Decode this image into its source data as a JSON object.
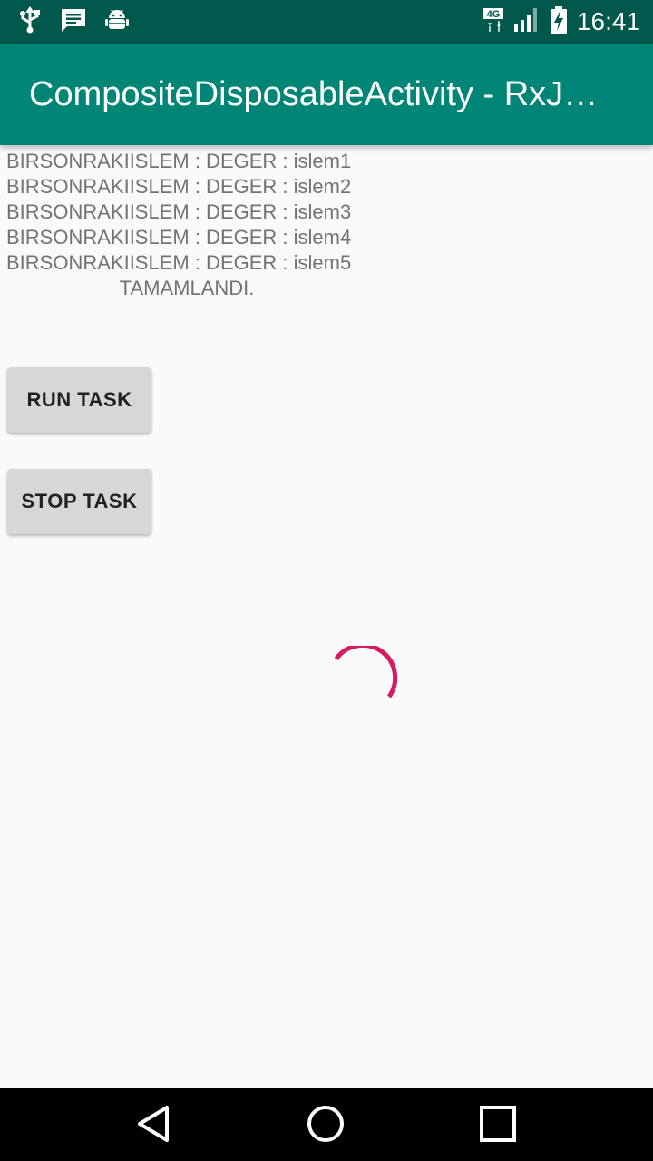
{
  "status_bar": {
    "icons_left": [
      "usb-icon",
      "message-icon",
      "android-debug-icon"
    ],
    "icons_right": [
      "network-4g-icon",
      "signal-icon",
      "battery-charging-icon"
    ],
    "network_label": "4G",
    "time": "16:41"
  },
  "app_bar": {
    "title": "CompositeDisposableActivity - RxJava"
  },
  "log": {
    "lines": [
      "BIRSONRAKIISLEM : DEGER : islem1",
      "BIRSONRAKIISLEM : DEGER : islem2",
      "BIRSONRAKIISLEM : DEGER : islem3",
      "BIRSONRAKIISLEM : DEGER : islem4",
      "BIRSONRAKIISLEM : DEGER : islem5"
    ],
    "completed": "TAMAMLANDI."
  },
  "buttons": {
    "run_label": "RUN TASK",
    "stop_label": "STOP TASK"
  },
  "spinner": {
    "color": "#d81b60"
  },
  "nav_bar": {
    "icons": [
      "back-icon",
      "home-icon",
      "recents-icon"
    ]
  },
  "colors": {
    "status_bar": "#00574b",
    "app_bar": "#008577",
    "accent": "#d81b60",
    "background": "#fafafa"
  }
}
